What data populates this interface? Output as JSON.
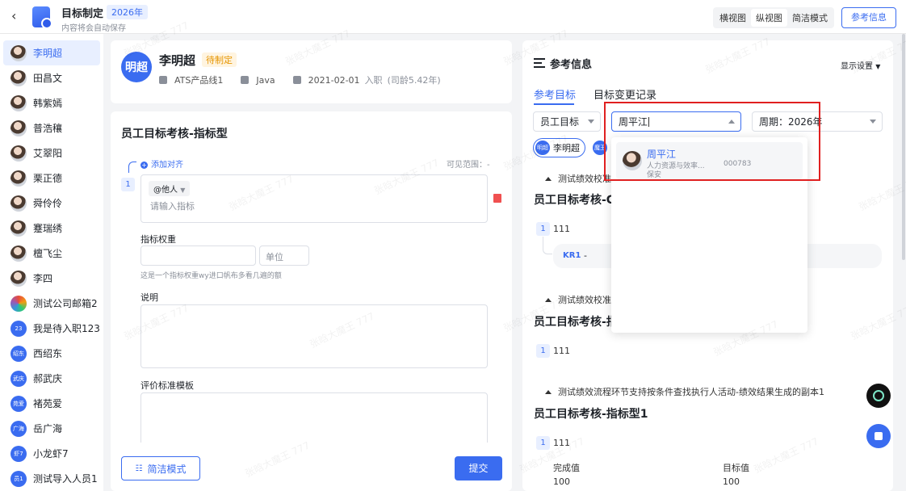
{
  "header": {
    "title": "目标制定",
    "year_tag": "2026年",
    "subtitle": "内容将会自动保存",
    "views": [
      "横视图",
      "纵视图",
      "简洁模式"
    ],
    "ref_button": "参考信息"
  },
  "sidebar": {
    "people": [
      {
        "name": "李明超",
        "avatar": "photo",
        "active": true
      },
      {
        "name": "田昌文",
        "avatar": "photo"
      },
      {
        "name": "韩紫嫣",
        "avatar": "photo"
      },
      {
        "name": "普浩穰",
        "avatar": "photo"
      },
      {
        "name": "艾翠阳",
        "avatar": "photo"
      },
      {
        "name": "栗正德",
        "avatar": "photo"
      },
      {
        "name": "舜伶伶",
        "avatar": "photo"
      },
      {
        "name": "蹇瑞绣",
        "avatar": "photo"
      },
      {
        "name": "檀飞尘",
        "avatar": "photo"
      },
      {
        "name": "李四",
        "avatar": "photo"
      },
      {
        "name": "测试公司邮箱2",
        "avatar": "color"
      },
      {
        "name": "我是待入职123",
        "avatar": "text",
        "short": "23"
      },
      {
        "name": "西绍东",
        "avatar": "text",
        "short": "绍东"
      },
      {
        "name": "郝武庆",
        "avatar": "text",
        "short": "武庆"
      },
      {
        "name": "褚苑爱",
        "avatar": "text",
        "short": "苑爱"
      },
      {
        "name": "岳广海",
        "avatar": "text",
        "short": "广海"
      },
      {
        "name": "小龙虾7",
        "avatar": "text",
        "short": "虾7"
      },
      {
        "name": "测试导入人员1",
        "avatar": "text",
        "short": "员1"
      }
    ]
  },
  "profile": {
    "avatar_text": "明超",
    "name": "李明超",
    "status": "待制定",
    "dept": "ATS产品线1",
    "job": "Java",
    "join_date": "2021-02-01",
    "join_suffix": "入职",
    "tenure": "(司龄5.42年)"
  },
  "form": {
    "title": "员工目标考核-指标型",
    "add_align": "添加对齐",
    "visible_range": "可见范围：-",
    "index": "1",
    "mention": "@他人",
    "indicator_placeholder": "请输入指标",
    "weight_label": "指标权重",
    "unit_placeholder": "单位",
    "weight_hint": "这是一个指标权重wy进口帆布多看几遍的额",
    "desc_label": "说明",
    "criteria_label": "评价标准模板",
    "simple_mode_button": "简洁模式",
    "submit_button": "提交"
  },
  "reference": {
    "title": "参考信息",
    "display_settings": "显示设置",
    "tabs": [
      "参考目标",
      "目标变更记录"
    ],
    "filter_type": "员工目标",
    "search_value": "周平江",
    "period": "周期：2026年",
    "chip_short": "明超",
    "chip_name": "李明超",
    "chip2_short": "魔王",
    "section1": "测试绩效校准",
    "goal1_title": "员工目标考核-C",
    "goal1_item": "111",
    "kr_label": "KR1",
    "kr_value": "-",
    "section2": "测试绩效校准",
    "goal2_title": "员工目标考核-指",
    "goal2_item": "111",
    "section3": "测试绩效流程环节支持按条件查找执行人活动-绩效结果生成的副本1",
    "goal3_title": "员工目标考核-指标型1",
    "goal3_item": "111",
    "col_done": "完成值",
    "col_target": "目标值",
    "val_done": "100",
    "val_target": "100"
  },
  "dropdown": {
    "name": "周平江",
    "dept": "人力资源与效率...",
    "id": "000783",
    "role": "保安"
  },
  "watermark": "张晗大魔王 777"
}
